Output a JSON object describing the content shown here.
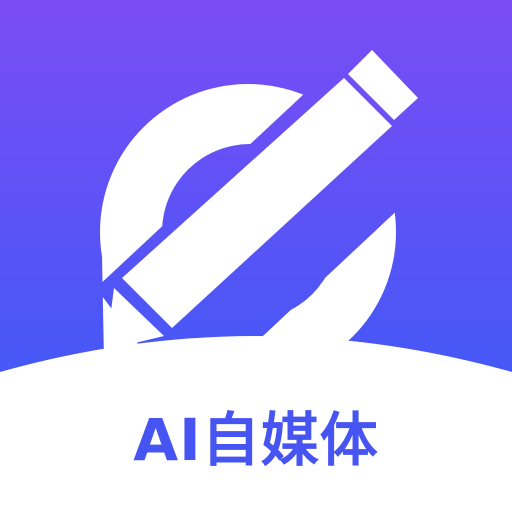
{
  "app": {
    "name": "AI自媒体"
  },
  "icon": {
    "symbol": "chat-bubble-pencil-icon"
  },
  "colors": {
    "gradient_top": "#7b4cf5",
    "gradient_bottom": "#4558f6",
    "symbol": "#ffffff",
    "label": "#4654f2",
    "background": "#ffffff"
  }
}
